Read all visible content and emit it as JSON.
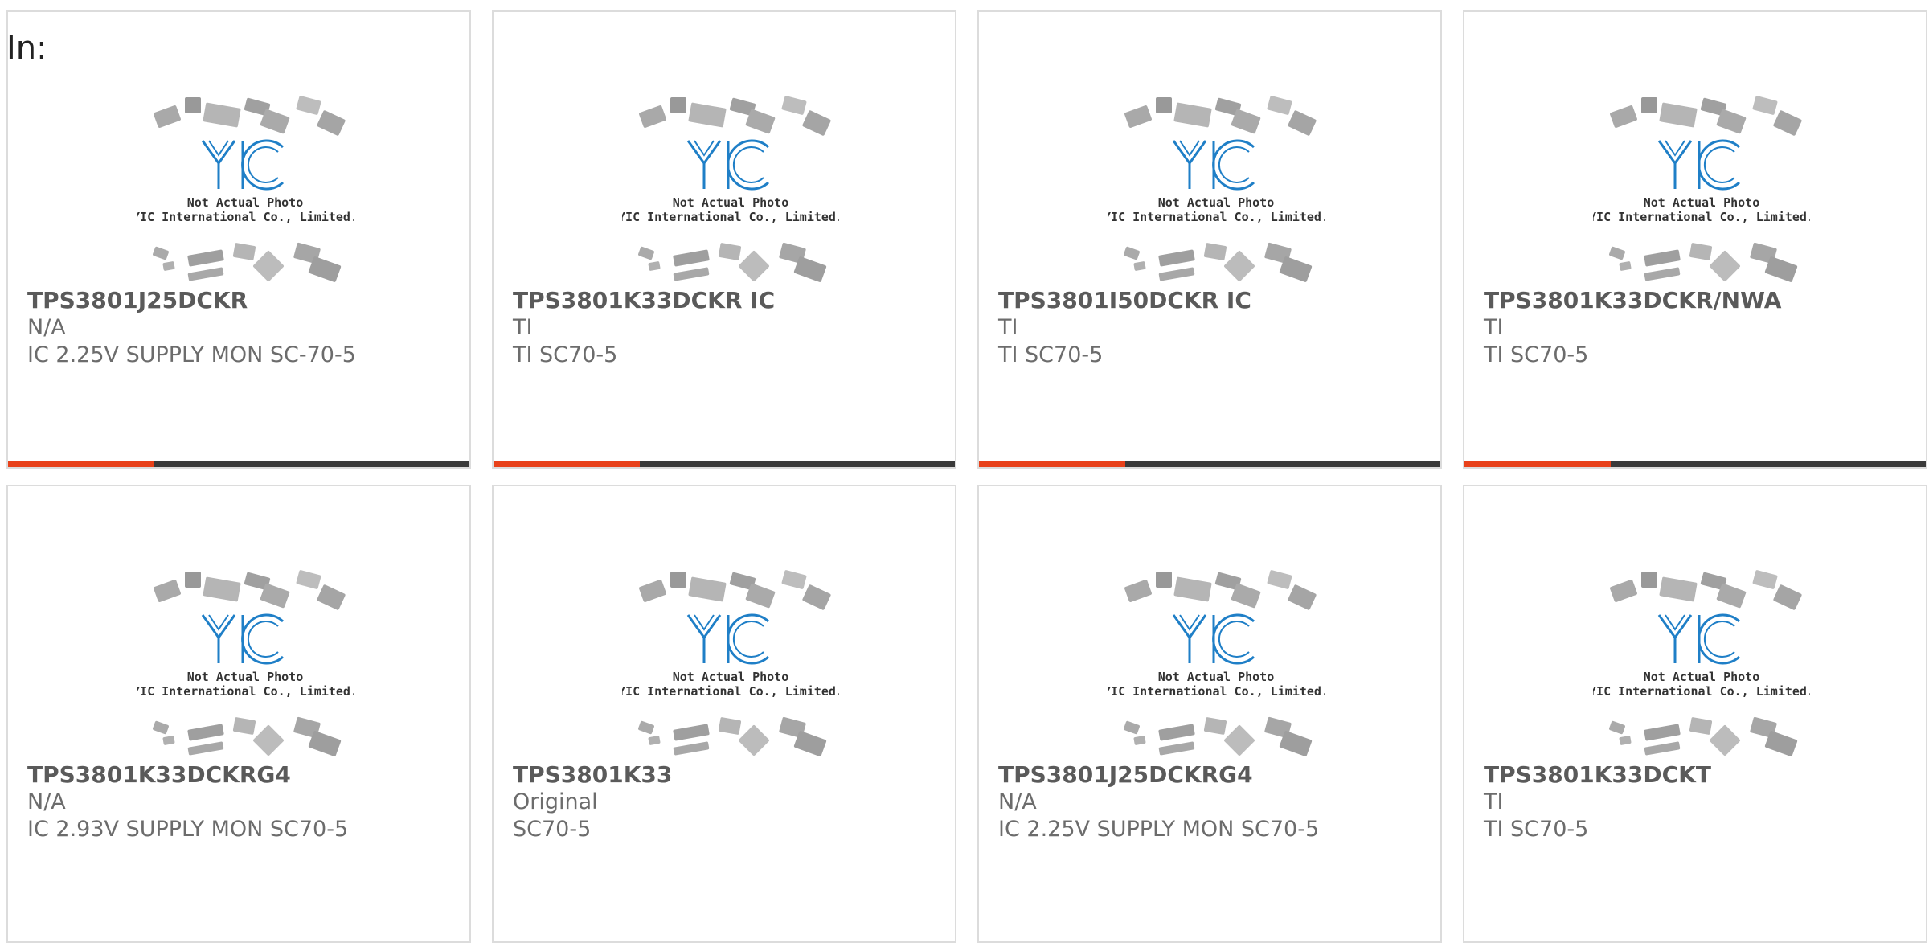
{
  "page": {
    "in_label": "In:"
  },
  "photo_placeholder": {
    "line1": "Not Actual Photo",
    "line2": "YIC International Co., Limited.",
    "logo": "YIC"
  },
  "colors": {
    "accent": "#e8411a",
    "bar": "#3a3a3a",
    "logo_blue": "#1f7fc7",
    "chip_gray": "#a9a9a9"
  },
  "products": [
    {
      "part": "TPS3801J25DCKR",
      "manufacturer": "N/A",
      "description": "IC 2.25V SUPPLY MON SC-70-5"
    },
    {
      "part": "TPS3801K33DCKR IC",
      "manufacturer": "TI",
      "description": "TI SC70-5"
    },
    {
      "part": "TPS3801I50DCKR IC",
      "manufacturer": "TI",
      "description": "TI SC70-5"
    },
    {
      "part": "TPS3801K33DCKR/NWA",
      "manufacturer": "TI",
      "description": "TI SC70-5"
    },
    {
      "part": "TPS3801K33DCKRG4",
      "manufacturer": "N/A",
      "description": "IC 2.93V SUPPLY MON SC70-5"
    },
    {
      "part": "TPS3801K33",
      "manufacturer": "Original",
      "description": "SC70-5"
    },
    {
      "part": "TPS3801J25DCKRG4",
      "manufacturer": "N/A",
      "description": "IC 2.25V SUPPLY MON SC70-5"
    },
    {
      "part": "TPS3801K33DCKT",
      "manufacturer": "TI",
      "description": "TI SC70-5"
    }
  ]
}
